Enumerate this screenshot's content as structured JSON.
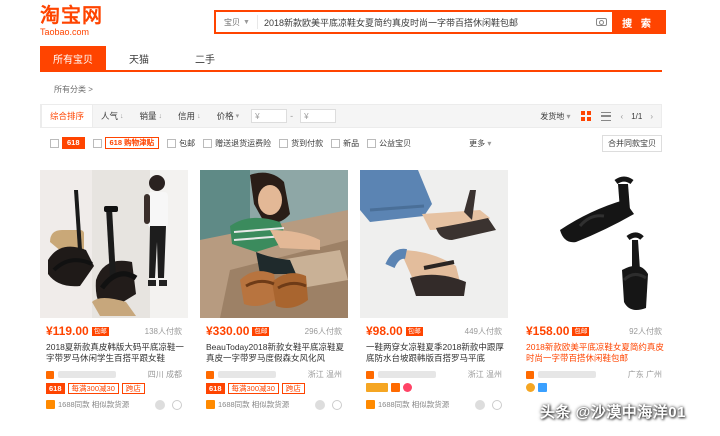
{
  "header": {
    "logo_cn": "淘宝网",
    "logo_en": "Taobao.com",
    "search_type": "宝贝",
    "search_query": "2018新款欧美平底凉鞋女夏简约真皮时尚一字带百搭休闲鞋包邮",
    "search_button": "搜 索"
  },
  "tabs": [
    "所有宝贝",
    "天猫",
    "二手"
  ],
  "breadcrumb": "所有分类 >",
  "sortbar": {
    "items": [
      "综合排序",
      "人气",
      "销量",
      "信用",
      "价格"
    ],
    "price_from": "¥",
    "price_to": "¥",
    "ship_from": "发货地",
    "page": "1/1"
  },
  "filters": {
    "badge_618": "618",
    "badge_618_fill": "618",
    "badge_618_fill_text": "购物津贴",
    "items": [
      "包邮",
      "赠送退货运费险",
      "货到付款",
      "新品",
      "公益宝贝"
    ],
    "more": "更多",
    "combo": "合并同款宝贝"
  },
  "products": [
    {
      "price": "¥119.00",
      "baoyou": "包邮",
      "paid": "138人付款",
      "title": "2018夏新款真皮韩版大码平底凉鞋一字带罗马休闲学生百搭平跟女鞋",
      "location": "四川 成都",
      "tag618": "618",
      "promo": "每满300减30",
      "promo_extra": "跨店",
      "svc": "1688同款 相似款货源"
    },
    {
      "price": "¥330.00",
      "baoyou": "包邮",
      "paid": "296人付款",
      "title": "BeauToday2018新款女鞋平底凉鞋夏真皮一字带罗马度假森女风化风",
      "location": "浙江 温州",
      "tag618": "618",
      "promo": "每满300减30",
      "promo_extra": "跨店",
      "svc": "1688同款 相似款货源"
    },
    {
      "price": "¥98.00",
      "baoyou": "包邮",
      "paid": "449人付款",
      "title": "一鞋两穿女凉鞋夏季2018新款中跟厚底防水台坡跟韩版百搭罗马平底",
      "location": "浙江 温州",
      "tag618": "",
      "promo": "",
      "promo_extra": "",
      "svc": "1688同款 相似款货源"
    },
    {
      "price": "¥158.00",
      "baoyou": "包邮",
      "paid": "92人付款",
      "title": "2018新款欧美平底凉鞋女夏简约真皮时尚一字带百搭休闲鞋包邮",
      "location": "广东 广州",
      "tag618": "",
      "promo": "",
      "promo_extra": "",
      "svc": ""
    }
  ],
  "watermark": "头条 @沙漠中海洋01",
  "colors": {
    "accent": "#ff4400"
  }
}
